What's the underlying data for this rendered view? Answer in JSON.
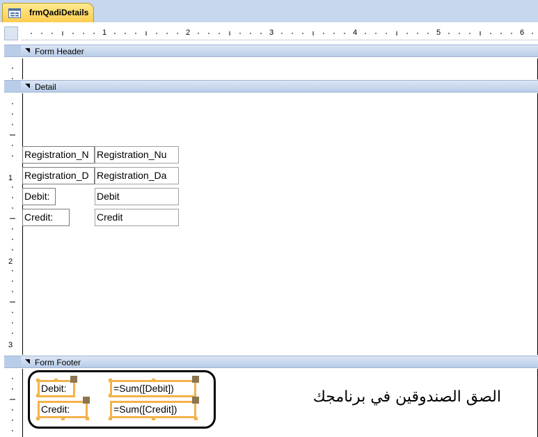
{
  "tab": {
    "title": "frmQadiDetails",
    "icon": "form-icon"
  },
  "ruler": {
    "horizontal_numbers": [
      "1",
      "2",
      "3",
      "4",
      "5",
      "6"
    ],
    "vertical_numbers": [
      "1",
      "2",
      "3"
    ]
  },
  "sections": {
    "form_header": {
      "label": "Form Header"
    },
    "detail": {
      "label": "Detail"
    },
    "form_footer": {
      "label": "Form Footer"
    }
  },
  "detail_controls": {
    "reg_number_label": "Registration_N",
    "reg_number_field": "Registration_Nu",
    "reg_date_label": "Registration_D",
    "reg_date_field": "Registration_Da",
    "debit_label": "Debit:",
    "debit_field": "Debit",
    "credit_label": "Credit:",
    "credit_field": "Credit"
  },
  "footer_controls": {
    "debit_label": "Debit:",
    "debit_sum": "=Sum([Debit])",
    "credit_label": "Credit:",
    "credit_sum": "=Sum([Credit])"
  },
  "annotation": {
    "note": "الصق الصندوقين في برنامجك"
  },
  "colors": {
    "tab_bg": "#ffcc4a",
    "section_bar": "#b9cde8",
    "selection": "#f3b24a",
    "handle": "#8c7550"
  }
}
